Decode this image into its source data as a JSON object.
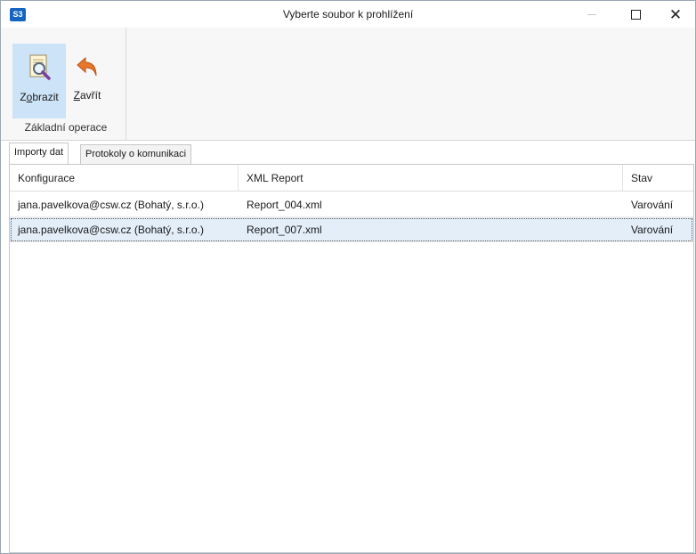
{
  "window": {
    "app_icon": "S3",
    "title": "Vyberte soubor k prohlížení",
    "icons": {
      "minimize": "minimize-icon",
      "maximize": "maximize-icon",
      "close": "close-icon"
    }
  },
  "ribbon": {
    "show": {
      "label_mnemonic": "o",
      "label_prefix": "Z",
      "label_rest": "brazit",
      "icon": "magnifier-document-icon"
    },
    "close": {
      "label_mnemonic": "Z",
      "label_rest": "avřít",
      "icon": "undo-arrow-icon"
    },
    "group_label": "Základní operace"
  },
  "tabs": [
    {
      "label": "Importy dat",
      "active": true
    },
    {
      "label": "Protokoly o komunikaci",
      "active": false
    }
  ],
  "grid": {
    "columns": [
      "Konfigurace",
      "XML Report",
      "Stav"
    ],
    "rows": [
      {
        "config": "jana.pavelkova@csw.cz (Bohatý, s.r.o.)",
        "report": "Report_004.xml",
        "status": "Varování"
      },
      {
        "config": "jana.pavelkova@csw.cz (Bohatý, s.r.o.)",
        "report": "Report_007.xml",
        "status": "Varování",
        "selected": true
      }
    ]
  },
  "colors": {
    "accent": "#cde3f7",
    "selection": "#e3eef9",
    "app_icon": "#1565c0",
    "undo_arrow": "#e8762c"
  }
}
